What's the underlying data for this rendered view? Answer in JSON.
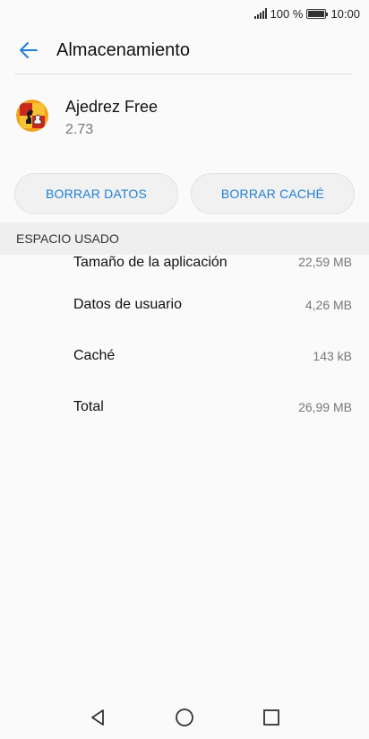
{
  "status_bar": {
    "battery": "100 %",
    "time": "10:00"
  },
  "app_bar": {
    "title": "Almacenamiento"
  },
  "app": {
    "name": "Ajedrez Free",
    "version": "2.73"
  },
  "buttons": {
    "clear_data": "BORRAR DATOS",
    "clear_cache": "BORRAR CACHÉ"
  },
  "section": {
    "header": "ESPACIO USADO",
    "rows": [
      {
        "label": "Tamaño de la aplicación",
        "value": "22,59 MB"
      },
      {
        "label": "Datos de usuario",
        "value": "4,26 MB"
      },
      {
        "label": "Caché",
        "value": "143 kB"
      },
      {
        "label": "Total",
        "value": "26,99 MB"
      }
    ]
  },
  "colors": {
    "accent": "#1f7fd6",
    "background": "#fafafa"
  },
  "icons": [
    "signal-icon",
    "battery-icon",
    "back-arrow-icon",
    "chess-app-icon",
    "nav-back-icon",
    "nav-home-icon",
    "nav-recents-icon"
  ]
}
